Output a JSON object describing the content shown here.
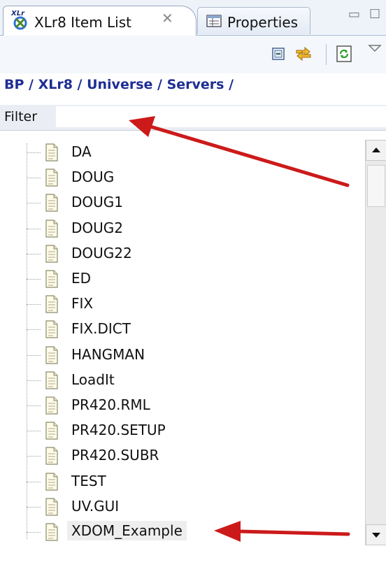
{
  "tabs": [
    {
      "label": "XLr8 Item List",
      "active": true,
      "icon": "xlr8-app-icon"
    },
    {
      "label": "Properties",
      "active": false,
      "icon": "properties-icon"
    }
  ],
  "toolbar": {
    "buttons": [
      "collapse-all-icon",
      "link-with-editor-icon",
      "refresh-icon",
      "view-menu-icon"
    ]
  },
  "breadcrumb": "BP / XLr8 / Universe / Servers /",
  "filter": {
    "label": "Filter",
    "value": ""
  },
  "tree": {
    "items": [
      "DA",
      "DOUG",
      "DOUG1",
      "DOUG2",
      "DOUG22",
      "ED",
      "FIX",
      "FIX.DICT",
      "HANGMAN",
      "LoadIt",
      "PR420.RML",
      "PR420.SETUP",
      "PR420.SUBR",
      "TEST",
      "UV.GUI",
      "XDOM_Example"
    ],
    "selected": "XDOM_Example"
  },
  "colors": {
    "breadcrumb": "#1e2e94",
    "arrow": "#cc1a1a",
    "tab_border": "#99a8be"
  }
}
